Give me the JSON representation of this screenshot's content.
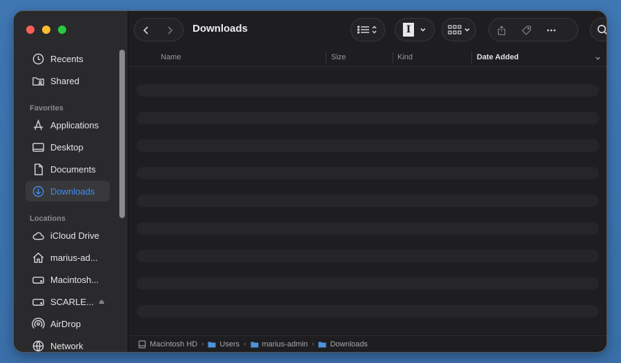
{
  "window": {
    "title": "Downloads"
  },
  "sidebar": {
    "sections": {
      "favorites": "Favorites",
      "locations": "Locations"
    },
    "top_items": [
      {
        "label": "Recents",
        "icon": "clock-icon"
      },
      {
        "label": "Shared",
        "icon": "shared-folder-icon"
      }
    ],
    "favorites": [
      {
        "label": "Applications",
        "icon": "applications-icon"
      },
      {
        "label": "Desktop",
        "icon": "desktop-icon"
      },
      {
        "label": "Documents",
        "icon": "document-icon"
      },
      {
        "label": "Downloads",
        "icon": "download-icon",
        "selected": true
      }
    ],
    "locations": [
      {
        "label": "iCloud Drive",
        "icon": "cloud-icon"
      },
      {
        "label": "marius-ad...",
        "icon": "home-icon"
      },
      {
        "label": "Macintosh...",
        "icon": "drive-icon"
      },
      {
        "label": "SCARLE...",
        "icon": "external-drive-icon",
        "eject": "⏏"
      },
      {
        "label": "AirDrop",
        "icon": "airdrop-icon"
      },
      {
        "label": "Network",
        "icon": "network-icon"
      }
    ]
  },
  "columns": {
    "name": "Name",
    "size": "Size",
    "kind": "Kind",
    "date_added": "Date Added"
  },
  "toolbar": {
    "text_cursor_glyph": "I"
  },
  "pathbar": {
    "crumbs": [
      "Macintosh HD",
      "Users",
      "marius-admin",
      "Downloads"
    ]
  },
  "colors": {
    "accent": "#3f8cf0",
    "close": "#fe5f57",
    "minimize": "#febc2e",
    "zoom": "#28c840"
  }
}
